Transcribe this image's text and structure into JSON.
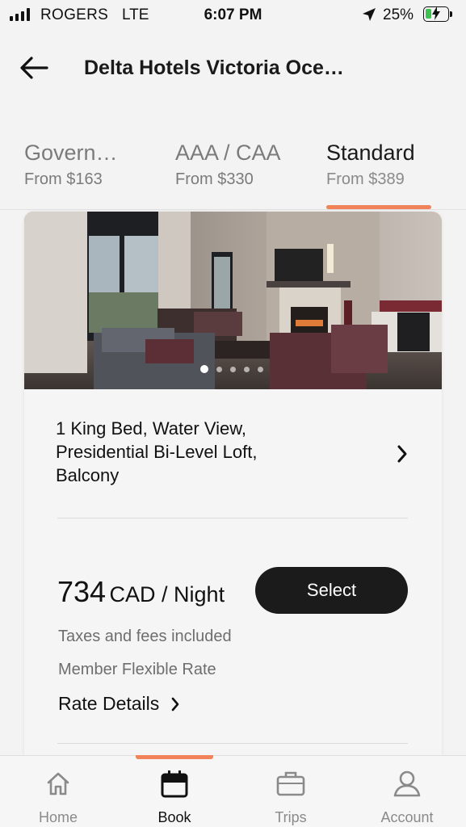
{
  "status_bar": {
    "carrier": "ROGERS",
    "network": "LTE",
    "time": "6:07 PM",
    "battery": "25%",
    "battery_level": 0.25,
    "battery_color": "#3bc251"
  },
  "header": {
    "back_icon": "arrow-left-icon",
    "title": "Delta Hotels Victoria Oce…"
  },
  "rate_tabs": [
    {
      "name": "Govern…",
      "price": "From $163",
      "active": false
    },
    {
      "name": "AAA / CAA",
      "price": "From $330",
      "active": false
    },
    {
      "name": "Standard",
      "price": "From $389",
      "active": true
    }
  ],
  "room": {
    "name": "1 King Bed, Water View, Presidential Bi-Level Loft, Balcony",
    "photo_count": 5,
    "active_photo": 1,
    "price_amount": "734",
    "price_unit": "CAD / Night",
    "select_label": "Select",
    "tax_note": "Taxes and fees included",
    "rate_name": "Member Flexible Rate",
    "rate_details_label": "Rate Details"
  },
  "bottom_nav": [
    {
      "label": "Home",
      "icon": "home-icon",
      "active": false
    },
    {
      "label": "Book",
      "icon": "calendar-icon",
      "active": true
    },
    {
      "label": "Trips",
      "icon": "suitcase-icon",
      "active": false
    },
    {
      "label": "Account",
      "icon": "user-icon",
      "active": false
    }
  ],
  "colors": {
    "accent": "#f0835a",
    "button_bg": "#1b1b1b",
    "page_bg": "#f3f3f3"
  }
}
